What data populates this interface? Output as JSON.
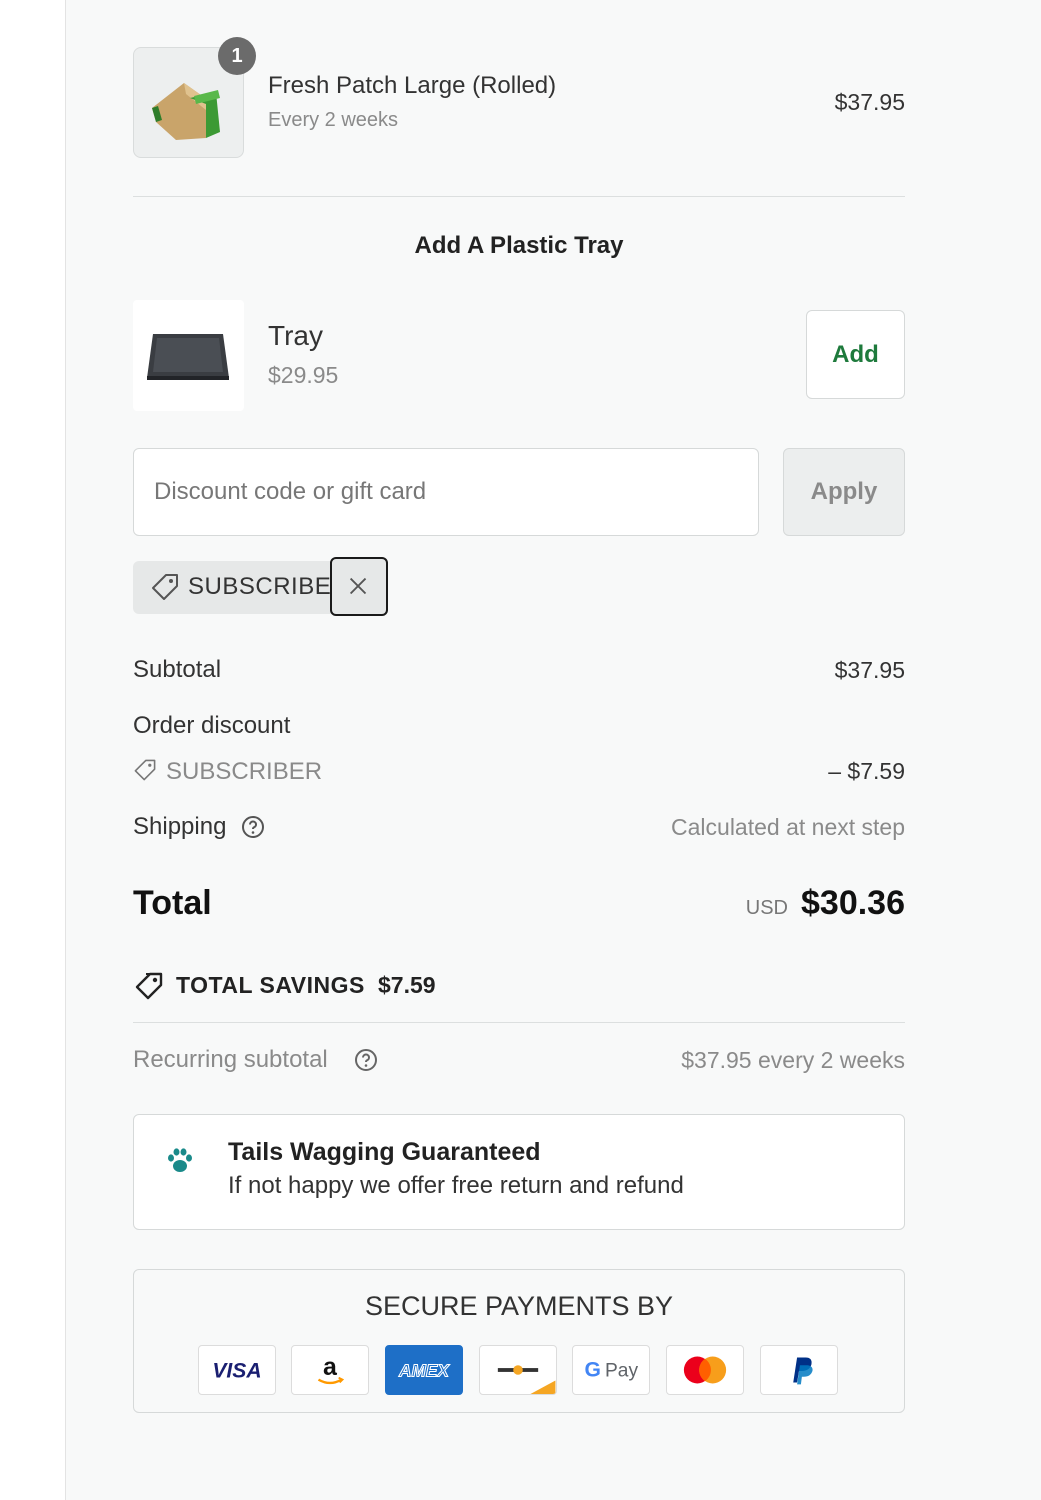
{
  "cart": {
    "item": {
      "quantity": "1",
      "name": "Fresh Patch Large (Rolled)",
      "frequency": "Every 2 weeks",
      "price": "$37.95"
    }
  },
  "upsell": {
    "heading": "Add A Plastic Tray",
    "product_name": "Tray",
    "product_price": "$29.95",
    "add_label": "Add"
  },
  "discount": {
    "placeholder": "Discount code or gift card",
    "apply_label": "Apply",
    "applied_code": "SUBSCRIBER"
  },
  "summary": {
    "subtotal_label": "Subtotal",
    "subtotal_value": "$37.95",
    "order_discount_label": "Order discount",
    "discount_code": "SUBSCRIBER",
    "discount_value": "– $7.59",
    "shipping_label": "Shipping",
    "shipping_value": "Calculated at next step",
    "total_label": "Total",
    "currency": "USD",
    "total_value": "$30.36",
    "savings_label": "TOTAL SAVINGS",
    "savings_value": "$7.59",
    "recurring_label": "Recurring subtotal",
    "recurring_value": "$37.95 every 2 weeks"
  },
  "guarantee": {
    "title": "Tails Wagging Guaranteed",
    "text": "If not happy we offer free return and refund"
  },
  "payments": {
    "title": "SECURE PAYMENTS BY",
    "methods": [
      "visa-icon",
      "amazon-pay-icon",
      "amex-icon",
      "discover-icon",
      "google-pay-icon",
      "mastercard-icon",
      "paypal-icon"
    ],
    "visa_text": "VISA",
    "amazon_text": "a",
    "amex_text": "AMEX",
    "gpay_text": "Pay"
  },
  "colors": {
    "panel_bg": "#f8f9f9",
    "accent_green": "#1e7a3c",
    "paw_teal": "#1a8a8a"
  }
}
